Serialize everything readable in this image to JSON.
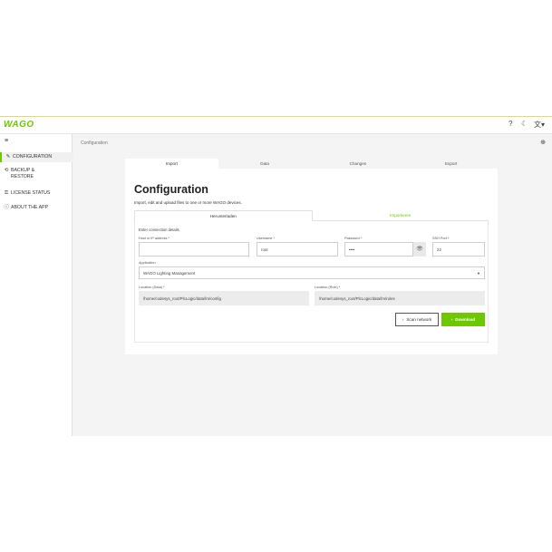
{
  "app": {
    "logo": "WAGO"
  },
  "topbar": {
    "help_icon": "help-icon",
    "theme_icon": "moon-icon",
    "lang_icon": "language-icon"
  },
  "sidebar": {
    "menu_icon": "hamburger-icon",
    "items": [
      {
        "label": "CONFIGURATION",
        "icon": "pencil-icon",
        "active": true
      },
      {
        "label": "BACKUP & RESTORE",
        "icon": "backup-icon"
      },
      {
        "label": "LICENSE STATUS",
        "icon": "key-icon"
      },
      {
        "label": "ABOUT THE APP",
        "icon": "info-icon"
      }
    ]
  },
  "breadcrumb": "Configuration",
  "top_tabs": [
    {
      "label": "Import",
      "active": true
    },
    {
      "label": "Data"
    },
    {
      "label": "Changes"
    },
    {
      "label": "Export"
    }
  ],
  "page": {
    "title": "Configuration",
    "subtitle": "Import, edit and upload files to one or more WAGO devices."
  },
  "inner_tabs": [
    {
      "label": "Herunterladen",
      "active": true
    },
    {
      "label": "Importieren"
    }
  ],
  "form": {
    "section_title": "Enter connection details",
    "host_label": "Host or IP address *",
    "host_value": "",
    "username_label": "Username *",
    "username_value": "root",
    "password_label": "Password *",
    "password_value": "••••",
    "ssh_port_label": "SSH Port *",
    "ssh_port_value": "22",
    "application_label": "Application",
    "application_value": "WAGO Lighting Management",
    "location_data_label": "Location (Data) *",
    "location_data_value": "/home/codesys_root/PlcLogic/data/lm/config",
    "location_rule_label": "Location (Rule) *",
    "location_rule_value": "/home/codesys_root/PlcLogic/data/lm/rules"
  },
  "buttons": {
    "scan": "Scan network",
    "download": "Download"
  },
  "colors": {
    "accent": "#6ec800"
  }
}
